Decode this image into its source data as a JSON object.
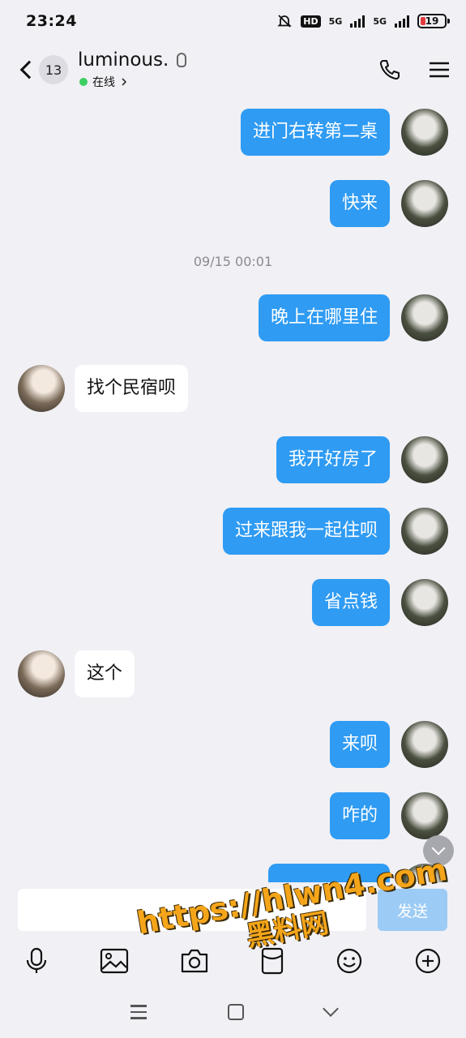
{
  "status_bar": {
    "time": "23:24",
    "hd_label": "HD",
    "net1": "5G",
    "net2": "5G",
    "battery": "19"
  },
  "header": {
    "unread_count": "13",
    "contact_name": "luminous.",
    "status": "在线"
  },
  "timestamps": [
    "09/15 00:01"
  ],
  "messages": [
    {
      "side": "out",
      "text": "进门右转第二桌"
    },
    {
      "side": "out",
      "text": "快来"
    },
    {
      "side": "out",
      "text": "晚上在哪里住"
    },
    {
      "side": "in",
      "text": "找个民宿呗"
    },
    {
      "side": "out",
      "text": "我开好房了"
    },
    {
      "side": "out",
      "text": "过来跟我一起住呗"
    },
    {
      "side": "out",
      "text": "省点钱"
    },
    {
      "side": "in",
      "text": "这个"
    },
    {
      "side": "out",
      "text": "来呗"
    },
    {
      "side": "out",
      "text": "咋的"
    },
    {
      "side": "out",
      "text": ""
    }
  ],
  "composer": {
    "input_value": "",
    "send_label": "发送"
  },
  "toolbar_icons": [
    "microphone-icon",
    "image-icon",
    "camera-icon",
    "red-packet-icon",
    "emoji-icon",
    "plus-icon"
  ],
  "watermark": {
    "url": "https://hlwn4.com",
    "text": "黑料网"
  },
  "colors": {
    "accent": "#2f9bf3",
    "background": "#f0f0f5",
    "online": "#3ccf62"
  }
}
